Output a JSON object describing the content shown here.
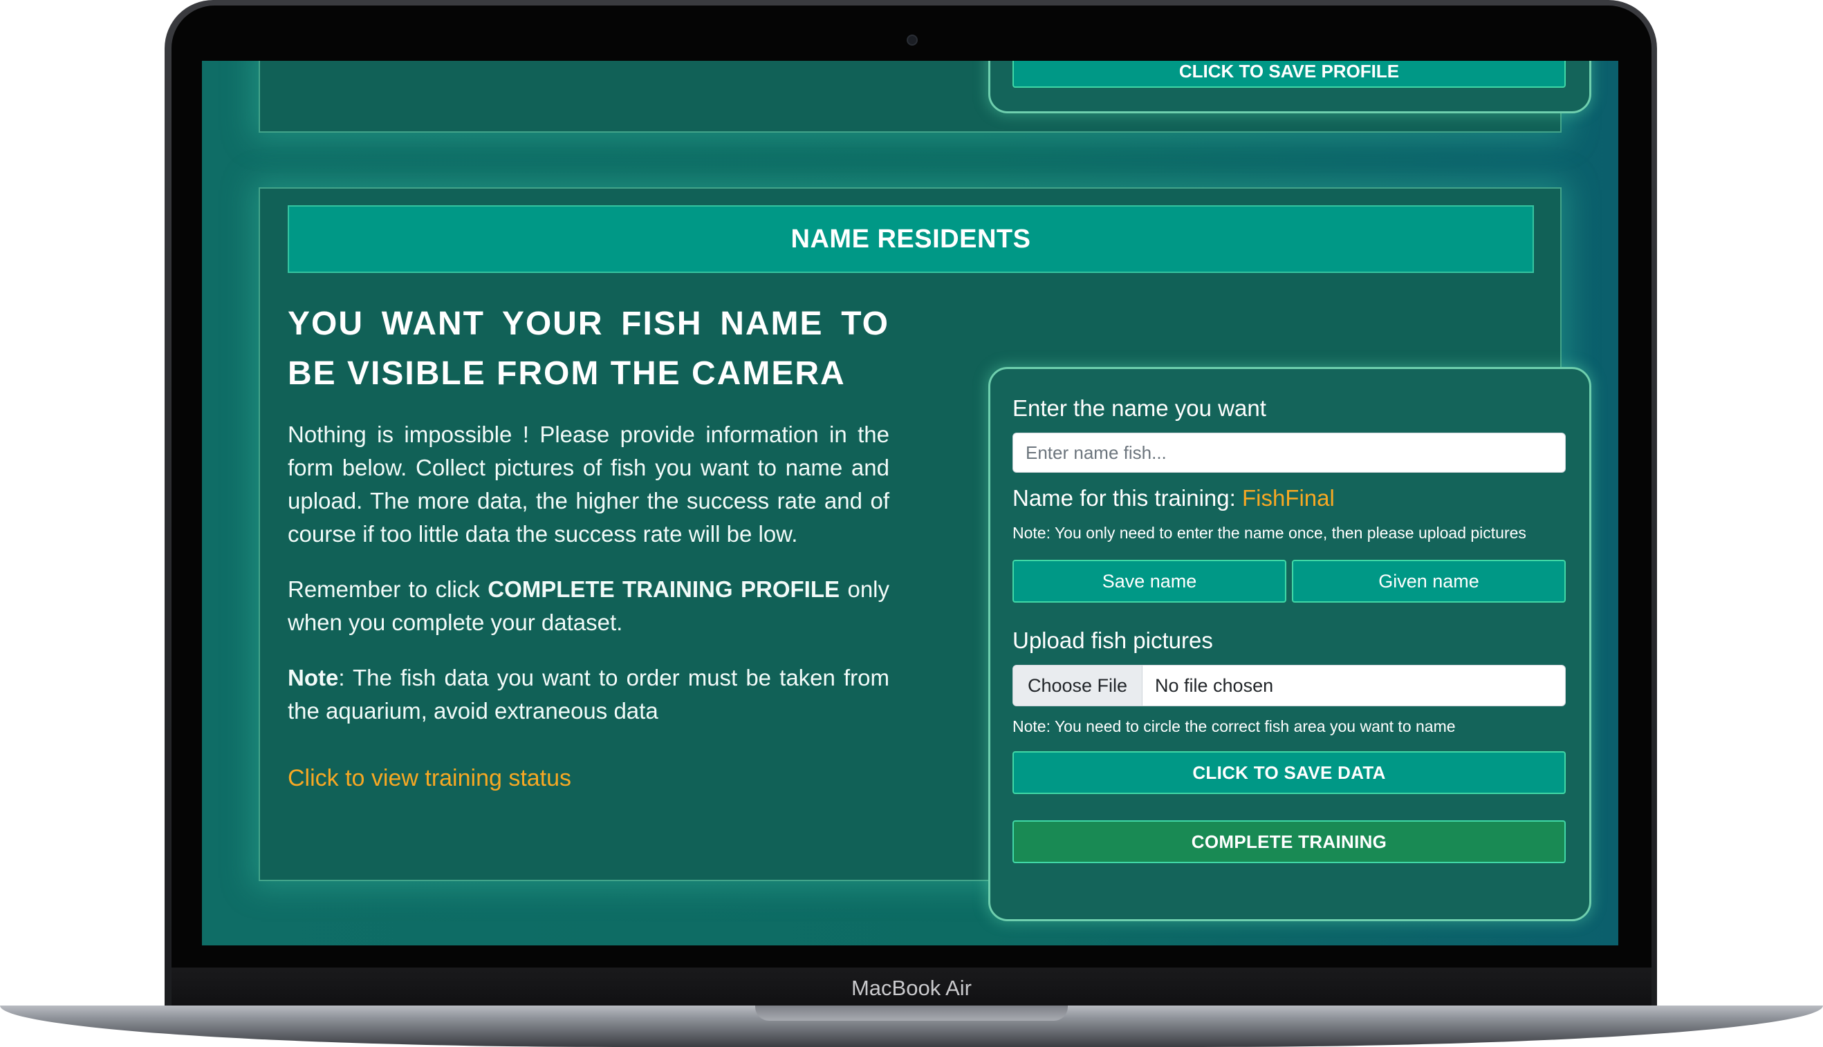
{
  "device": {
    "brand_label": "MacBook Air"
  },
  "top_section": {
    "button_label": "CLICK TO SAVE PROFILE"
  },
  "section": {
    "header": "NAME RESIDENTS",
    "heading": "YOU WANT YOUR FISH NAME TO BE VISIBLE FROM THE CAMERA",
    "paragraph1": "Nothing is impossible ! Please provide information in the form below. Collect pictures of fish you want to name and upload. The more data, the higher the success rate and of course if too little data the success rate will be low.",
    "paragraph2_prefix": "Remember to click ",
    "paragraph2_bold": "COMPLETE TRAINING PROFILE",
    "paragraph2_suffix": " only when you complete your dataset.",
    "note_bold": "Note",
    "note_text": ": The fish data you want to order must be taken from the aquarium, avoid extraneous data",
    "status_link": "Click to view training status"
  },
  "form": {
    "name_label": "Enter the name you want",
    "name_placeholder": "Enter name fish...",
    "training_label": "Name for this training: ",
    "training_name": "FishFinal",
    "name_note": "Note: You only need to enter the name once, then please upload pictures",
    "save_name_button": "Save name",
    "given_name_button": "Given name",
    "upload_label": "Upload fish pictures",
    "choose_file_button": "Choose File",
    "file_status": "No file chosen",
    "upload_note": "Note: You need to circle the correct fish area you want to name",
    "save_data_button": "CLICK TO SAVE DATA",
    "complete_button": "COMPLETE TRAINING"
  },
  "colors": {
    "accent_teal": "#009886",
    "link_orange": "#f7a823",
    "complete_green": "#198a54"
  }
}
